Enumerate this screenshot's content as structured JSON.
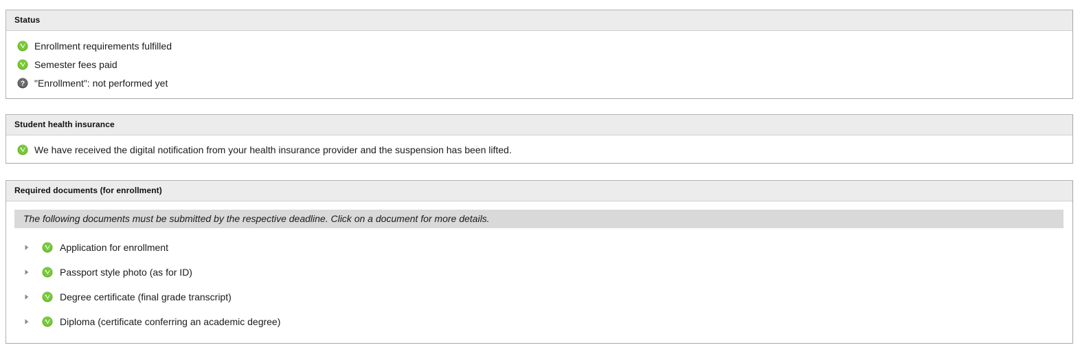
{
  "colors": {
    "panel_border": "#a6a6a6",
    "header_bg": "#ececec",
    "instruction_bg": "#d9d9d9",
    "check_green": "#63b521",
    "question_gray": "#5a5a5a",
    "text": "#1a1a1a",
    "triangle_gray": "#8c8c8c"
  },
  "status_panel": {
    "header": "Status",
    "items": [
      {
        "icon": "check-circle-icon",
        "label": "Enrollment requirements fulfilled"
      },
      {
        "icon": "check-circle-icon",
        "label": "Semester fees paid"
      },
      {
        "icon": "question-circle-icon",
        "label": "\"Enrollment\": not performed yet"
      }
    ]
  },
  "health_panel": {
    "header": "Student health insurance",
    "items": [
      {
        "icon": "check-circle-icon",
        "label": "We have received the digital notification from your health insurance provider and the suspension has been lifted."
      }
    ]
  },
  "documents_panel": {
    "header": "Required documents (for enrollment)",
    "instruction": "The following documents must be submitted by the respective deadline. Click on a document for more details.",
    "items": [
      {
        "expander": "expand-triangle-icon",
        "icon": "check-circle-icon",
        "label": "Application for enrollment"
      },
      {
        "expander": "expand-triangle-icon",
        "icon": "check-circle-icon",
        "label": "Passport style photo (as for ID)"
      },
      {
        "expander": "expand-triangle-icon",
        "icon": "check-circle-icon",
        "label": "Degree certificate (final grade transcript)"
      },
      {
        "expander": "expand-triangle-icon",
        "icon": "check-circle-icon",
        "label": "Diploma (certificate conferring an academic degree)"
      }
    ]
  }
}
